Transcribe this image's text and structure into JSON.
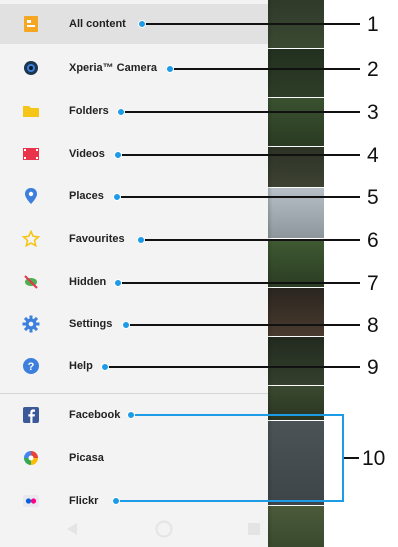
{
  "menu": {
    "items": [
      {
        "label": "All content",
        "icon": "all-content-icon",
        "color": "#f5a623"
      },
      {
        "label": "Xperia™ Camera",
        "icon": "camera-icon",
        "color": "#2b4a6b"
      },
      {
        "label": "Folders",
        "icon": "folder-icon",
        "color": "#f5c518"
      },
      {
        "label": "Videos",
        "icon": "video-icon",
        "color": "#e8334a"
      },
      {
        "label": "Places",
        "icon": "place-pin-icon",
        "color": "#3d7fdc"
      },
      {
        "label": "Favourites",
        "icon": "star-icon",
        "color": "#f5c518"
      },
      {
        "label": "Hidden",
        "icon": "hidden-icon",
        "color": "#4caf50"
      },
      {
        "label": "Settings",
        "icon": "gear-icon",
        "color": "#3d7fdc"
      },
      {
        "label": "Help",
        "icon": "help-icon",
        "color": "#3d7fdc"
      }
    ],
    "services": [
      {
        "label": "Facebook",
        "icon": "facebook-icon",
        "color": "#3b5998"
      },
      {
        "label": "Picasa",
        "icon": "picasa-icon",
        "color": "#e94335"
      },
      {
        "label": "Flickr",
        "icon": "flickr-icon",
        "color": "#0063dc"
      }
    ]
  },
  "callouts": [
    "1",
    "2",
    "3",
    "4",
    "5",
    "6",
    "7",
    "8",
    "9",
    "10"
  ],
  "navbar": {
    "buttons": [
      "back-icon",
      "home-icon",
      "recents-icon"
    ]
  },
  "colors": {
    "accent": "#1c9be6",
    "drawer_bg": "#f3f3f3",
    "selected_bg": "#e1e1e1"
  }
}
